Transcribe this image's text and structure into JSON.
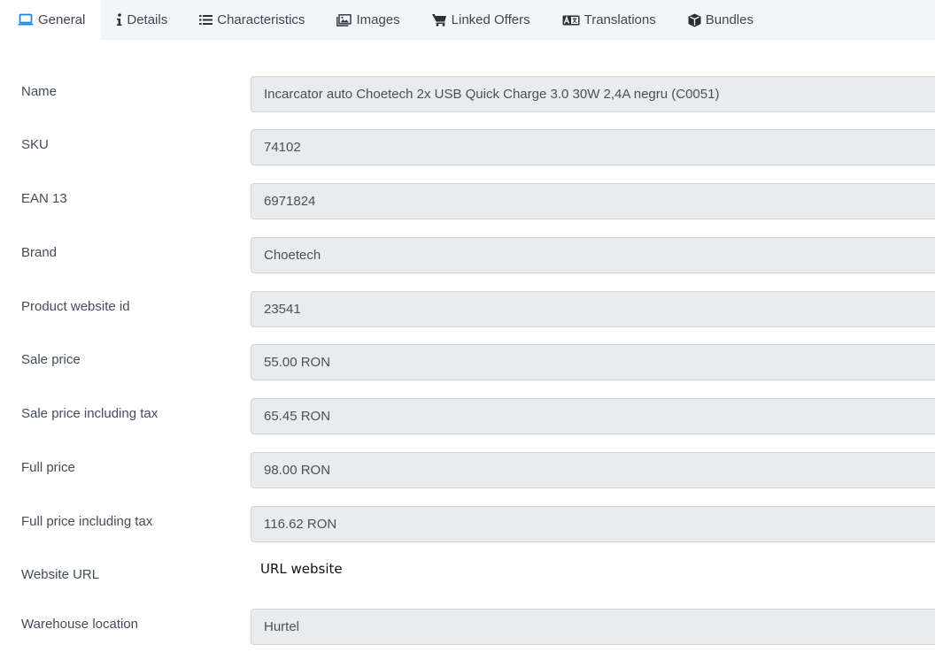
{
  "tabs": [
    {
      "label": "General",
      "icon": "laptop-icon"
    },
    {
      "label": "Details",
      "icon": "info-icon"
    },
    {
      "label": "Characteristics",
      "icon": "list-icon"
    },
    {
      "label": "Images",
      "icon": "image-icon"
    },
    {
      "label": "Linked Offers",
      "icon": "cart-icon"
    },
    {
      "label": "Translations",
      "icon": "translate-icon"
    },
    {
      "label": "Bundles",
      "icon": "box-icon"
    }
  ],
  "active_tab": "General",
  "accent_color": "#1e88e5",
  "fields": {
    "name": {
      "label": "Name",
      "value": "Incarcator auto Choetech 2x USB Quick Charge 3.0 30W 2,4A negru (C0051)"
    },
    "sku": {
      "label": "SKU",
      "value": "74102"
    },
    "ean": {
      "label": "EAN 13",
      "value": "6971824"
    },
    "brand": {
      "label": "Brand",
      "value": "Choetech"
    },
    "website_id": {
      "label": "Product website id",
      "value": "23541"
    },
    "sale_price": {
      "label": "Sale price",
      "value": "55.00 RON"
    },
    "sale_price_tax": {
      "label": "Sale price including tax",
      "value": "65.45 RON"
    },
    "full_price": {
      "label": "Full price",
      "value": "98.00 RON"
    },
    "full_price_tax": {
      "label": "Full price including tax",
      "value": "116.62 RON"
    },
    "website_url": {
      "label": "Website URL",
      "link_text": "URL website"
    },
    "warehouse": {
      "label": "Warehouse location",
      "value": "Hurtel"
    }
  }
}
